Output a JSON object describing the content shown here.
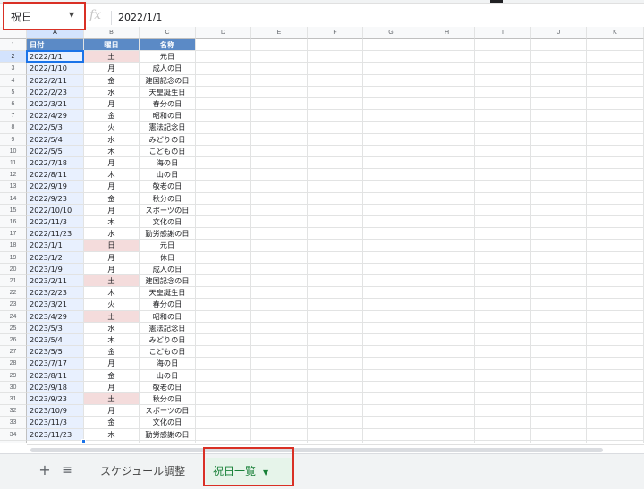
{
  "namebox": {
    "value": "祝日"
  },
  "formula": {
    "fx_label": "fx",
    "value": "2022/1/1"
  },
  "columns": [
    "A",
    "B",
    "C",
    "D",
    "E",
    "F",
    "G",
    "H",
    "I",
    "J",
    "K"
  ],
  "table": {
    "headers": [
      "日付",
      "曜日",
      "名称"
    ],
    "rows": [
      [
        "2022/1/1",
        "土",
        "元日"
      ],
      [
        "2022/1/10",
        "月",
        "成人の日"
      ],
      [
        "2022/2/11",
        "金",
        "建国記念の日"
      ],
      [
        "2022/2/23",
        "水",
        "天皇誕生日"
      ],
      [
        "2022/3/21",
        "月",
        "春分の日"
      ],
      [
        "2022/4/29",
        "金",
        "昭和の日"
      ],
      [
        "2022/5/3",
        "火",
        "憲法記念日"
      ],
      [
        "2022/5/4",
        "水",
        "みどりの日"
      ],
      [
        "2022/5/5",
        "木",
        "こどもの日"
      ],
      [
        "2022/7/18",
        "月",
        "海の日"
      ],
      [
        "2022/8/11",
        "木",
        "山の日"
      ],
      [
        "2022/9/19",
        "月",
        "敬老の日"
      ],
      [
        "2022/9/23",
        "金",
        "秋分の日"
      ],
      [
        "2022/10/10",
        "月",
        "スポーツの日"
      ],
      [
        "2022/11/3",
        "木",
        "文化の日"
      ],
      [
        "2022/11/23",
        "水",
        "勤労感謝の日"
      ],
      [
        "2023/1/1",
        "日",
        "元日"
      ],
      [
        "2023/1/2",
        "月",
        "休日"
      ],
      [
        "2023/1/9",
        "月",
        "成人の日"
      ],
      [
        "2023/2/11",
        "土",
        "建国記念の日"
      ],
      [
        "2023/2/23",
        "木",
        "天皇誕生日"
      ],
      [
        "2023/3/21",
        "火",
        "春分の日"
      ],
      [
        "2023/4/29",
        "土",
        "昭和の日"
      ],
      [
        "2023/5/3",
        "水",
        "憲法記念日"
      ],
      [
        "2023/5/4",
        "木",
        "みどりの日"
      ],
      [
        "2023/5/5",
        "金",
        "こどもの日"
      ],
      [
        "2023/7/17",
        "月",
        "海の日"
      ],
      [
        "2023/8/11",
        "金",
        "山の日"
      ],
      [
        "2023/9/18",
        "月",
        "敬老の日"
      ],
      [
        "2023/9/23",
        "土",
        "秋分の日"
      ],
      [
        "2023/10/9",
        "月",
        "スポーツの日"
      ],
      [
        "2023/11/3",
        "金",
        "文化の日"
      ],
      [
        "2023/11/23",
        "木",
        "勤労感謝の日"
      ]
    ]
  },
  "weekend_labels": [
    "土",
    "日"
  ],
  "colors": {
    "header_bg": "#5b8ac6",
    "weekend_bg": "#f4dcdc",
    "date_col_bg": "#e8f0fe",
    "active_tab": "#188038",
    "highlight": "#d93025"
  },
  "sheet_tabs": [
    {
      "label": "スケジュール調整",
      "active": false
    },
    {
      "label": "祝日一覧",
      "active": true
    }
  ],
  "icons": {
    "add": "plus-icon",
    "all": "list-icon",
    "caret": "caret-down-icon"
  }
}
